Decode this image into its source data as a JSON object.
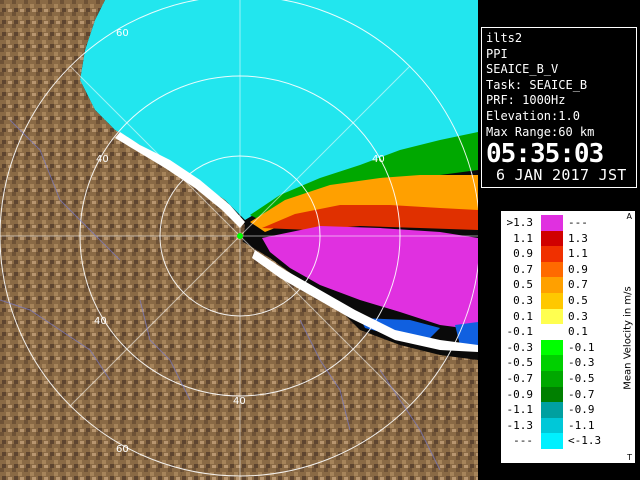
{
  "station": "ilts2",
  "scan_type": "PPI",
  "product": "SEAICE_B_V",
  "task": "Task: SEAICE_B",
  "prf": "PRF: 1000Hz",
  "elevation": "Elevation:1.0",
  "max_range": "Max Range:60 km",
  "time": "05:35:03",
  "date": "6 JAN 2017 JST",
  "range_ring_labels": [
    "60",
    "40",
    "40",
    "40",
    "40",
    "60"
  ],
  "legend": {
    "title": "Mean Velocity in m/s",
    "top_marker": "A",
    "bottom_marker": "T",
    "rows": [
      {
        "lo": ">1.3",
        "hi": "---",
        "color": "#e030e0"
      },
      {
        "lo": "1.1",
        "hi": "1.3",
        "color": "#d00000"
      },
      {
        "lo": "0.9",
        "hi": "1.1",
        "color": "#f03000"
      },
      {
        "lo": "0.7",
        "hi": "0.9",
        "color": "#ff6a00"
      },
      {
        "lo": "0.5",
        "hi": "0.7",
        "color": "#ffa000"
      },
      {
        "lo": "0.3",
        "hi": "0.5",
        "color": "#ffc800"
      },
      {
        "lo": "0.1",
        "hi": "0.3",
        "color": "#ffff50"
      },
      {
        "lo": "-0.1",
        "hi": "0.1",
        "color": "#ffffff"
      },
      {
        "lo": "-0.3",
        "hi": "-0.1",
        "color": "#00ff00"
      },
      {
        "lo": "-0.5",
        "hi": "-0.3",
        "color": "#00d000"
      },
      {
        "lo": "-0.7",
        "hi": "-0.5",
        "color": "#00a800"
      },
      {
        "lo": "-0.9",
        "hi": "-0.7",
        "color": "#008000"
      },
      {
        "lo": "-1.1",
        "hi": "-0.9",
        "color": "#00a0a0"
      },
      {
        "lo": "-1.3",
        "hi": "-1.1",
        "color": "#00c8d8"
      },
      {
        "lo": "---",
        "hi": "<-1.3",
        "color": "#00f0ff"
      }
    ]
  },
  "colors": {
    "sea_ice_cyan": "#22e6ee",
    "land_brown": "#8a6a45",
    "approach_magenta": "#e030e0",
    "receding_blue": "#1060e0",
    "rings": "#ffffff"
  }
}
